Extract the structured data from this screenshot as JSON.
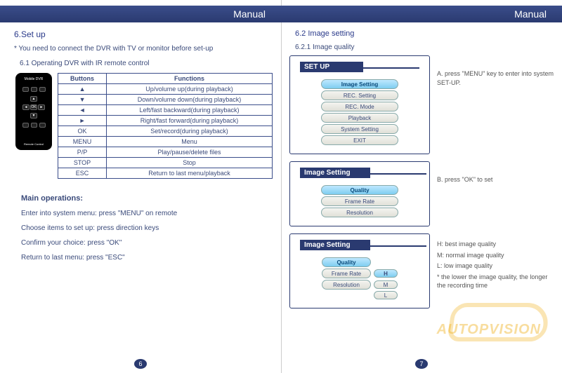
{
  "header": "Manual",
  "left": {
    "h1": "6.Set up",
    "note": "* You need to connect the DVR with TV or monitor before set-up",
    "sub": "6.1 Operating DVR with IR remote control",
    "remote": {
      "brand": "Mobile DVR",
      "ok": "OK",
      "foot": "Remote Control"
    },
    "table": {
      "head": [
        "Buttons",
        "Functions"
      ],
      "rows": [
        [
          "▲",
          "Up/volume up(during playback)"
        ],
        [
          "▼",
          "Down/volume down(during playback)"
        ],
        [
          "◄",
          "Left/fast backward(during playback)"
        ],
        [
          "►",
          "Right/fast forward(during playback)"
        ],
        [
          "OK",
          "Set/record(during playback)"
        ],
        [
          "MENU",
          "Menu"
        ],
        [
          "P/P",
          "Play/pause/delete files"
        ],
        [
          "STOP",
          "Stop"
        ],
        [
          "ESC",
          "Return to last menu/playback"
        ]
      ]
    },
    "ops": {
      "h": "Main operations:",
      "lines": [
        "Enter into system menu: press \"MENU\" on remote",
        "Choose items to set up: press direction keys",
        "Confirm your choice: press \"OK\"",
        "Return to last menu: press \"ESC\""
      ]
    },
    "pageNum": "6"
  },
  "right": {
    "h1": "6.2 Image setting",
    "h2": "6.2.1  Image quality",
    "screen1": {
      "title": "SET UP",
      "items": [
        "Image Setting",
        "REC. Setting",
        "REC. Mode",
        "Playback",
        "System Setting",
        "EXIT"
      ],
      "selectedIndex": 0,
      "desc": "A. press \"MENU\" key to enter into system SET-UP."
    },
    "screen2": {
      "title": "Image Setting",
      "items": [
        "Quality",
        "Frame Rate",
        "Resolution"
      ],
      "selectedIndex": 0,
      "desc": "B. press \"OK\" to set"
    },
    "screen3": {
      "title": "Image Setting",
      "rows": [
        {
          "label": "Quality",
          "selected": true
        },
        {
          "label": "Frame Rate",
          "value": "H",
          "valSelected": true
        },
        {
          "label": "Resolution",
          "value": "M"
        },
        {
          "label": "",
          "value": "L"
        }
      ],
      "desc": [
        "H:  best image quality",
        "M: normal image quality",
        "L:  low image quality",
        "* the lower the image quality, the longer the recording time"
      ]
    },
    "pageNum": "7",
    "watermark": "AUTOPVISION"
  }
}
